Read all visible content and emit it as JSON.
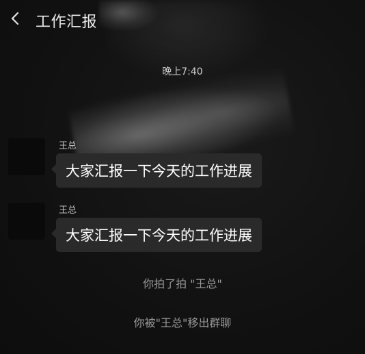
{
  "header": {
    "title": "工作汇报",
    "back_icon": "chevron-left-icon"
  },
  "chat": {
    "timestamp": "晚上7:40",
    "messages": [
      {
        "sender": "王总",
        "text": "大家汇报一下今天的工作进展"
      },
      {
        "sender": "王总",
        "text": "大家汇报一下今天的工作进展"
      }
    ],
    "system_messages": [
      "你拍了拍 \"王总\"",
      "你被\"王总\"移出群聊"
    ]
  },
  "colors": {
    "background": "#121212",
    "bubble": "#2a2a2a",
    "text": "#ffffff",
    "system_text": "#9a9a9a"
  }
}
